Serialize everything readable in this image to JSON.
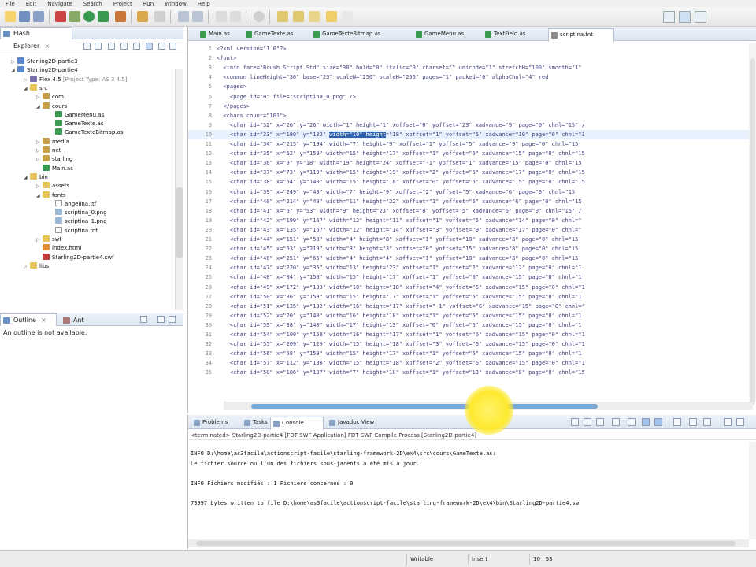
{
  "menu": [
    "File",
    "Edit",
    "Navigate",
    "Search",
    "Project",
    "Run",
    "Window",
    "Help"
  ],
  "explorer": {
    "title": "Flash Explorer",
    "tree": [
      {
        "label": "Starling2D-partie3",
        "sub": "",
        "icon": "proj",
        "tw": "▷"
      },
      {
        "label": "Starling2D-partie4",
        "sub": "",
        "icon": "proj",
        "tw": "◢"
      },
      {
        "label": "Flex 4.5",
        "sub": " [Project Type: AS 3 4.5]",
        "icon": "lib",
        "tw": "▷"
      },
      {
        "label": "src",
        "sub": "",
        "icon": "fold",
        "tw": "◢"
      },
      {
        "label": "com",
        "sub": "",
        "icon": "pkg",
        "tw": "▷"
      },
      {
        "label": "cours",
        "sub": "",
        "icon": "pkg",
        "tw": "◢"
      },
      {
        "label": "GameMenu.as",
        "sub": "",
        "icon": "as",
        "tw": ""
      },
      {
        "label": "GameTexte.as",
        "sub": "",
        "icon": "as",
        "tw": ""
      },
      {
        "label": "GameTexteBitmap.as",
        "sub": "",
        "icon": "as",
        "tw": ""
      },
      {
        "label": "media",
        "sub": "",
        "icon": "pkg",
        "tw": "▷"
      },
      {
        "label": "net",
        "sub": "",
        "icon": "pkg",
        "tw": "▷"
      },
      {
        "label": "starling",
        "sub": "",
        "icon": "pkg",
        "tw": "▷"
      },
      {
        "label": "Main.as",
        "sub": "",
        "icon": "as",
        "tw": ""
      },
      {
        "label": "bin",
        "sub": "",
        "icon": "fold",
        "tw": "◢"
      },
      {
        "label": "assets",
        "sub": "",
        "icon": "fold",
        "tw": "▷"
      },
      {
        "label": "fonts",
        "sub": "",
        "icon": "fold",
        "tw": "◢"
      },
      {
        "label": "angelina.ttf",
        "sub": "",
        "icon": "file",
        "tw": ""
      },
      {
        "label": "scriptina_0.png",
        "sub": "",
        "icon": "img",
        "tw": ""
      },
      {
        "label": "scriptina_1.png",
        "sub": "",
        "icon": "img",
        "tw": ""
      },
      {
        "label": "scriptina.fnt",
        "sub": "",
        "icon": "file",
        "tw": ""
      },
      {
        "label": "swf",
        "sub": "",
        "icon": "fold",
        "tw": "▷"
      },
      {
        "label": "index.html",
        "sub": "",
        "icon": "html",
        "tw": ""
      },
      {
        "label": "Starling2D-partie4.swf",
        "sub": "",
        "icon": "swf",
        "tw": ""
      },
      {
        "label": "libs",
        "sub": "",
        "icon": "fold",
        "tw": "▷"
      }
    ]
  },
  "outline": {
    "tab1": "Outline",
    "tab2": "Ant",
    "message": "An outline is not available."
  },
  "editor": {
    "tabs": [
      "Main.as",
      "GameTexte.as",
      "GameTexteBitmap.as",
      "GameMenu.as",
      "TextField.as",
      "scriptina.fnt"
    ],
    "active_tab": 5,
    "lines": [
      {
        "n": "1",
        "t": "<?xml version=\"1.0\"?>"
      },
      {
        "n": "2",
        "t": "<font>"
      },
      {
        "n": "3",
        "t": "  <info face=\"Brush Script Std\" size=\"30\" bold=\"0\" italic=\"0\" charset=\"\" unicode=\"1\" stretchH=\"100\" smooth=\"1\""
      },
      {
        "n": "4",
        "t": "  <common lineHeight=\"30\" base=\"23\" scaleW=\"256\" scaleH=\"256\" pages=\"1\" packed=\"0\" alphaChnl=\"4\" red"
      },
      {
        "n": "5",
        "t": "  <pages>"
      },
      {
        "n": "6",
        "t": "    <page id=\"0\" file=\"scriptina_0.png\" />"
      },
      {
        "n": "7",
        "t": "  </pages>"
      },
      {
        "n": "8",
        "t": "  <chars count=\"101\">"
      },
      {
        "n": "9",
        "t": "    <char id=\"32\" x=\"26\" y=\"26\" width=\"1\" height=\"1\" xoffset=\"0\" yoffset=\"23\" xadvance=\"9\" page=\"0\" chnl=\"15\" /"
      },
      {
        "n": "10",
        "t": "    <char id=\"33\" x=\"180\" y=\"133\" width=\"10\" height=\"18\" xoffset=\"1\" yoffset=\"5\" xadvance=\"10\" page=\"0\" chnl=\"1"
      },
      {
        "n": "11",
        "t": "    <char id=\"34\" x=\"215\" y=\"194\" width=\"7\" height=\"9\" xoffset=\"1\" yoffset=\"5\" xadvance=\"9\" page=\"0\" chnl=\"15"
      },
      {
        "n": "12",
        "t": "    <char id=\"35\" x=\"52\" y=\"159\" width=\"15\" height=\"17\" xoffset=\"1\" yoffset=\"6\" xadvance=\"15\" page=\"0\" chnl=\"15"
      },
      {
        "n": "13",
        "t": "    <char id=\"36\" x=\"0\" y=\"18\" width=\"19\" height=\"24\" xoffset=\"-1\" yoffset=\"1\" xadvance=\"15\" page=\"0\" chnl=\"15"
      },
      {
        "n": "14",
        "t": "    <char id=\"37\" x=\"73\" y=\"119\" width=\"15\" height=\"19\" xoffset=\"2\" yoffset=\"5\" xadvance=\"17\" page=\"0\" chnl=\"15"
      },
      {
        "n": "15",
        "t": "    <char id=\"38\" x=\"54\" y=\"140\" width=\"15\" height=\"18\" xoffset=\"0\" yoffset=\"5\" xadvance=\"15\" page=\"0\" chnl=\"15"
      },
      {
        "n": "16",
        "t": "    <char id=\"39\" x=\"249\" y=\"49\" width=\"7\" height=\"9\" xoffset=\"2\" yoffset=\"5\" xadvance=\"6\" page=\"0\" chnl=\"15"
      },
      {
        "n": "17",
        "t": "    <char id=\"40\" x=\"214\" y=\"49\" width=\"11\" height=\"22\" xoffset=\"1\" yoffset=\"5\" xadvance=\"6\" page=\"0\" chnl=\"15"
      },
      {
        "n": "18",
        "t": "    <char id=\"41\" x=\"6\" y=\"53\" width=\"9\" height=\"23\" xoffset=\"0\" yoffset=\"5\" xadvance=\"6\" page=\"0\" chnl=\"15\" /"
      },
      {
        "n": "19",
        "t": "    <char id=\"42\" x=\"199\" y=\"167\" width=\"12\" height=\"11\" xoffset=\"1\" yoffset=\"5\" xadvance=\"14\" page=\"0\" chnl=\""
      },
      {
        "n": "20",
        "t": "    <char id=\"43\" x=\"135\" y=\"167\" width=\"12\" height=\"14\" xoffset=\"3\" yoffset=\"9\" xadvance=\"17\" page=\"0\" chnl=\""
      },
      {
        "n": "21",
        "t": "    <char id=\"44\" x=\"151\" y=\"58\" width=\"4\" height=\"8\" xoffset=\"1\" yoffset=\"18\" xadvance=\"8\" page=\"0\" chnl=\"15"
      },
      {
        "n": "22",
        "t": "    <char id=\"45\" x=\"63\" y=\"219\" width=\"8\" height=\"3\" xoffset=\"0\" yoffset=\"15\" xadvance=\"8\" page=\"0\" chnl=\"15"
      },
      {
        "n": "23",
        "t": "    <char id=\"46\" x=\"251\" y=\"65\" width=\"4\" height=\"4\" xoffset=\"1\" yoffset=\"18\" xadvance=\"8\" page=\"0\" chnl=\"15"
      },
      {
        "n": "24",
        "t": "    <char id=\"47\" x=\"220\" y=\"35\" width=\"13\" height=\"23\" xoffset=\"1\" yoffset=\"2\" xadvance=\"12\" page=\"0\" chnl=\"1"
      },
      {
        "n": "25",
        "t": "    <char id=\"48\" x=\"84\" y=\"158\" width=\"15\" height=\"17\" xoffset=\"1\" yoffset=\"6\" xadvance=\"15\" page=\"0\" chnl=\"1"
      },
      {
        "n": "26",
        "t": "    <char id=\"49\" x=\"172\" y=\"133\" width=\"10\" height=\"18\" xoffset=\"4\" yoffset=\"6\" xadvance=\"15\" page=\"0\" chnl=\"1"
      },
      {
        "n": "27",
        "t": "    <char id=\"50\" x=\"36\" y=\"159\" width=\"15\" height=\"17\" xoffset=\"1\" yoffset=\"6\" xadvance=\"15\" page=\"0\" chnl=\"1"
      },
      {
        "n": "28",
        "t": "    <char id=\"51\" x=\"135\" y=\"132\" width=\"16\" height=\"17\" xoffset=\"-1\" yoffset=\"6\" xadvance=\"15\" page=\"0\" chnl=\""
      },
      {
        "n": "29",
        "t": "    <char id=\"52\" x=\"20\" y=\"140\" width=\"16\" height=\"18\" xoffset=\"1\" yoffset=\"6\" xadvance=\"15\" page=\"0\" chnl=\"1"
      },
      {
        "n": "30",
        "t": "    <char id=\"53\" x=\"38\" y=\"140\" width=\"17\" height=\"13\" xoffset=\"0\" yoffset=\"6\" xadvance=\"15\" page=\"0\" chnl=\"1"
      },
      {
        "n": "31",
        "t": "    <char id=\"54\" x=\"100\" y=\"158\" width=\"16\" height=\"17\" xoffset=\"1\" yoffset=\"6\" xadvance=\"15\" page=\"0\" chnl=\"1"
      },
      {
        "n": "32",
        "t": "    <char id=\"55\" x=\"209\" y=\"129\" width=\"15\" height=\"18\" xoffset=\"3\" yoffset=\"6\" xadvance=\"15\" page=\"0\" chnl=\"1"
      },
      {
        "n": "33",
        "t": "    <char id=\"56\" x=\"68\" y=\"159\" width=\"15\" height=\"17\" xoffset=\"1\" yoffset=\"6\" xadvance=\"15\" page=\"0\" chnl=\"1"
      },
      {
        "n": "34",
        "t": "    <char id=\"57\" x=\"112\" y=\"136\" width=\"15\" height=\"18\" xoffset=\"2\" yoffset=\"6\" xadvance=\"15\" page=\"0\" chnl=\"1"
      },
      {
        "n": "35",
        "t": "    <char id=\"58\" x=\"186\" y=\"197\" width=\"7\" height=\"10\" xoffset=\"1\" yoffset=\"13\" xadvance=\"8\" page=\"0\" chnl=\"15"
      }
    ]
  },
  "console": {
    "tabs": [
      "Problems",
      "Tasks",
      "Console",
      "Javadoc View"
    ],
    "active_tab": 2,
    "terminated": "<terminated> Starling2D-partie4 [FDT SWF Application] FDT SWF Compile Process [Starling2D-partie4]",
    "lines": [
      "INFO D:\\home\\as3facile\\actionscript-facile\\starling-framework-2D\\ex4\\src\\cours\\GameTexte.as:",
      "Le fichier source ou l'un des fichiers sous-jacents a été mis à jour.",
      "",
      "INFO Fichiers modifiés : 1 Fichiers concernés : 0",
      "",
      "73997 bytes written to file D:\\home\\as3facile\\actionscript-facile\\starling-framework-2D\\ex4\\bin\\Starling2D-partie4.sw"
    ]
  },
  "status": {
    "writable": "Writable",
    "insert": "Insert",
    "position": "10 : 53"
  },
  "colors": {
    "selection": "#3062b0",
    "highlight_cursor": "#ffe92f",
    "tabbar": "#dde6f1"
  }
}
